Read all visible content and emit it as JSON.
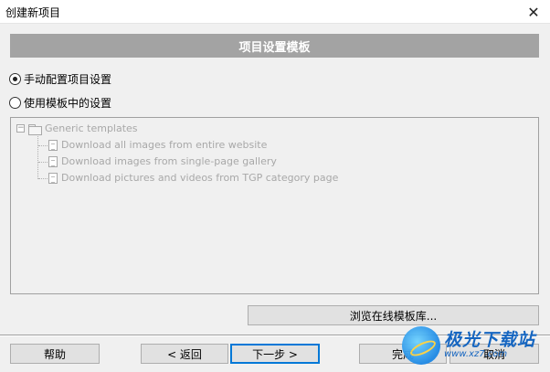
{
  "window": {
    "title": "创建新项目",
    "close_label": "✕"
  },
  "banner": {
    "title": "项目设置模板"
  },
  "options": [
    {
      "label": "手动配置项目设置",
      "checked": true
    },
    {
      "label": "使用模板中的设置",
      "checked": false
    }
  ],
  "tree": {
    "root": {
      "expander": "−",
      "label": "Generic templates"
    },
    "items": [
      {
        "label": "Download all images from entire website"
      },
      {
        "label": "Download images from single-page gallery"
      },
      {
        "label": "Download pictures and videos from TGP category page"
      }
    ]
  },
  "browse_button": {
    "label": "浏览在线模板库..."
  },
  "footer": {
    "help": "帮助",
    "back": "< 返回",
    "next": "下一步 >",
    "finish": "完成",
    "cancel": "取消"
  },
  "watermark": {
    "name": "极光下载站",
    "url": "www.xz7.com"
  },
  "colors": {
    "banner_bg": "#a3a3a3",
    "focus_border": "#0078d7",
    "watermark": "#1565c0"
  }
}
